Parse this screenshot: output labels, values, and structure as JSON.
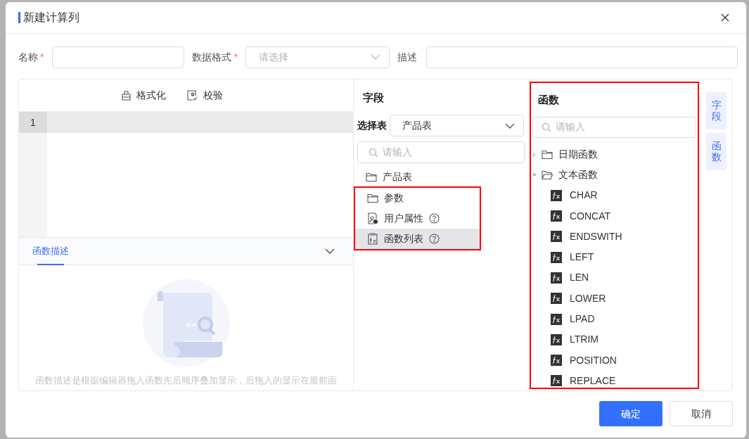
{
  "dialog": {
    "title": "新建计算列"
  },
  "form": {
    "name_label": "名称",
    "name_required_mark": "*",
    "format_label": "数据格式",
    "format_required_mark": "*",
    "format_placeholder": "请选择",
    "desc_label": "描述"
  },
  "editor": {
    "toolbar": [
      "格式化",
      "校验"
    ],
    "line_numbers": [
      "1"
    ]
  },
  "description": {
    "tab": "函数描述",
    "empty_text": "函数描述是根据编辑器拖入函数先后顺序叠加显示，后拖入的显示在最前面"
  },
  "fields": {
    "title": "字段",
    "table_label": "选择表",
    "table_value": "产品表",
    "search_placeholder": "请输入",
    "items": [
      {
        "kind": "folder",
        "label": "产品表",
        "help": false,
        "selected": false,
        "highlighted": false
      },
      {
        "kind": "folder",
        "label": "参数",
        "help": false,
        "selected": false,
        "highlighted": true
      },
      {
        "kind": "user",
        "label": "用户属性",
        "help": true,
        "selected": false,
        "highlighted": true
      },
      {
        "kind": "function-list",
        "label": "函数列表",
        "help": true,
        "selected": true,
        "highlighted": true
      }
    ]
  },
  "functions": {
    "title": "函数",
    "search_placeholder": "请输入",
    "highlighted": true,
    "groups": [
      {
        "label": "日期函数",
        "expanded": false
      },
      {
        "label": "文本函数",
        "expanded": true,
        "children": [
          {
            "label": "CHAR"
          },
          {
            "label": "CONCAT"
          },
          {
            "label": "ENDSWITH"
          },
          {
            "label": "LEFT"
          },
          {
            "label": "LEN"
          },
          {
            "label": "LOWER"
          },
          {
            "label": "LPAD"
          },
          {
            "label": "LTRIM"
          },
          {
            "label": "POSITION"
          },
          {
            "label": "REPLACE"
          }
        ]
      }
    ]
  },
  "side_tabs": [
    {
      "label": "字段",
      "selected": false
    },
    {
      "label": "函数",
      "selected": false
    }
  ],
  "buttons": [
    {
      "kind": "primary",
      "label": "确定"
    },
    {
      "kind": "default",
      "label": "取消"
    }
  ]
}
